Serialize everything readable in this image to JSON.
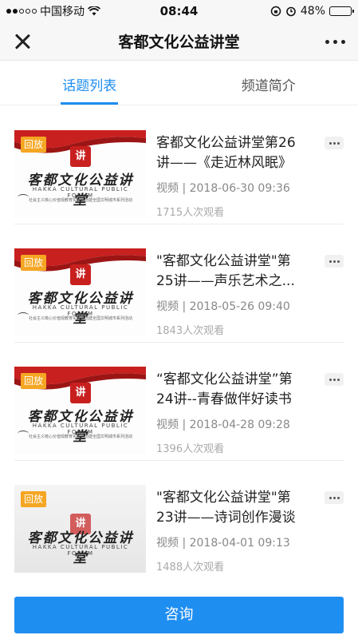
{
  "status_bar": {
    "carrier": "中国移动",
    "time": "08:44",
    "battery_text": "48%",
    "battery_level": 0.48
  },
  "nav": {
    "title": "客都文化公益讲堂"
  },
  "tabs": [
    {
      "label": "话题列表",
      "active": true
    },
    {
      "label": "频道简介",
      "active": false
    }
  ],
  "thumbnail": {
    "badge": "回放",
    "brand_text": "客都文化公益讲堂",
    "english_text": "HAKKA CULTURAL PUBLIC FORUM",
    "subtitle_text": "社会主义核心价值观教育实践暨创建全国文明城市系列活动"
  },
  "items": [
    {
      "title": "客都文化公益讲堂第26讲——《走近林风眠》",
      "meta": "视频 | 2018-06-30 09:36",
      "views": "1715人次观看"
    },
    {
      "title": "\"客都文化公益讲堂\"第25讲——声乐艺术之...",
      "meta": "视频 | 2018-05-26 09:40",
      "views": "1843人次观看"
    },
    {
      "title": "“客都文化公益讲堂”第24讲--青春做伴好读书",
      "meta": "视频 | 2018-04-28 09:28",
      "views": "1396人次观看"
    },
    {
      "title": "\"客都文化公益讲堂\"第23讲——诗词创作漫谈",
      "meta": "视频 | 2018-04-01 09:13",
      "views": "1488人次观看"
    }
  ],
  "bottom": {
    "button_label": "咨询"
  },
  "colors": {
    "accent": "#1f8ef1",
    "badge": "#f5a623",
    "seal": "#c8201f"
  }
}
